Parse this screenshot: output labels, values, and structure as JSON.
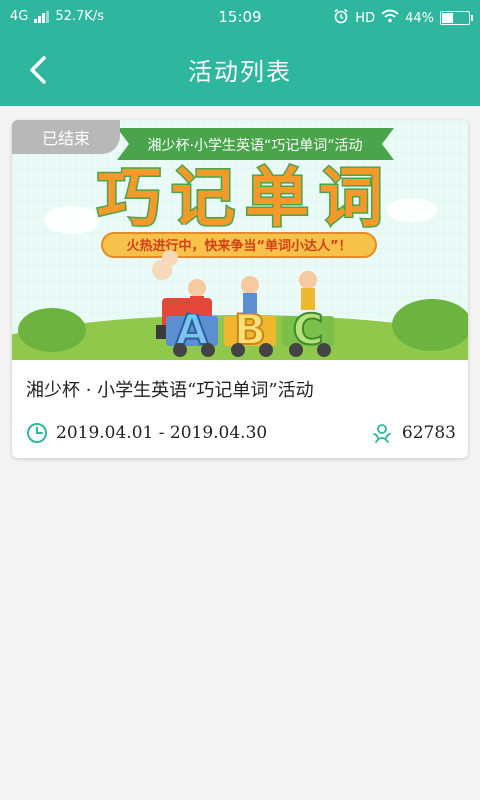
{
  "status_bar": {
    "network": "4G",
    "speed": "52.7K/s",
    "time": "15:09",
    "hd": "HD",
    "battery": "44%",
    "battery_level": 0.44
  },
  "header": {
    "title": "活动列表",
    "back_icon": "chevron-left-icon"
  },
  "activity": {
    "status": "已结束",
    "banner": {
      "ribbon_text": "湘少杯·小学生英语“巧记单词”活动",
      "headline": "巧记单词",
      "slogan": "火热进行中，快来争当“单词小达人”！",
      "letters": [
        "A",
        "B",
        "C"
      ]
    },
    "title": "湘少杯 · 小学生英语“巧记单词”活动",
    "date_range": "2019.04.01 - 2019.04.30",
    "participants": "62783"
  },
  "colors": {
    "primary": "#2fb69f",
    "banner_green": "#4aa44c",
    "headline_orange": "#f39a2b",
    "tag_gray": "#b8b8b8"
  }
}
